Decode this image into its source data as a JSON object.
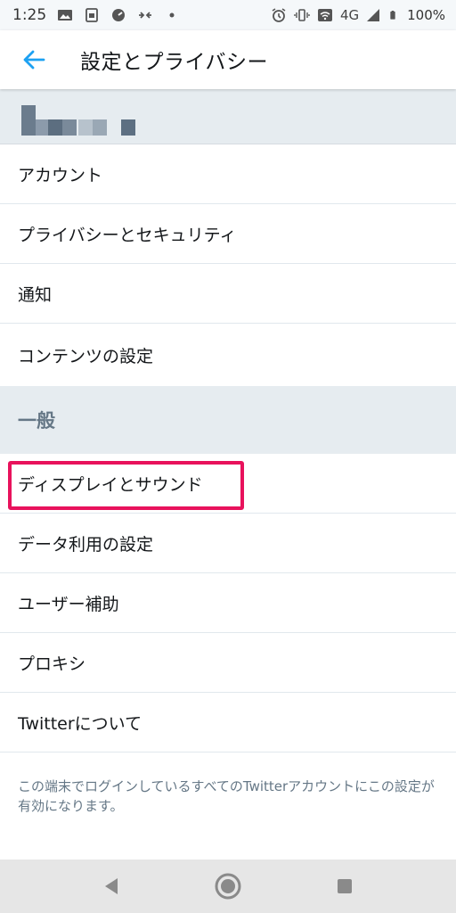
{
  "status_bar": {
    "time": "1:25",
    "network": "4G",
    "battery": "100%"
  },
  "header": {
    "title": "設定とプライバシー"
  },
  "account_rows": [
    {
      "label": "アカウント"
    },
    {
      "label": "プライバシーとセキュリティ"
    },
    {
      "label": "通知"
    },
    {
      "label": "コンテンツの設定"
    }
  ],
  "general": {
    "section_label": "一般",
    "rows": [
      {
        "label": "ディスプレイとサウンド"
      },
      {
        "label": "データ利用の設定"
      },
      {
        "label": "ユーザー補助"
      },
      {
        "label": "プロキシ"
      },
      {
        "label": "Twitterについて"
      }
    ]
  },
  "footer_note": "この端末でログインしているすべてのTwitterアカウントにこの設定が有効になります。",
  "colors": {
    "accent": "#1da1f2",
    "highlight": "#e8125c",
    "section_bg": "#e6ecf0",
    "secondary_text": "#657786"
  },
  "icons": {
    "back": "arrow-left-icon",
    "nav_back": "triangle-back-icon",
    "nav_home": "circle-home-icon",
    "nav_recent": "square-recent-icon"
  }
}
